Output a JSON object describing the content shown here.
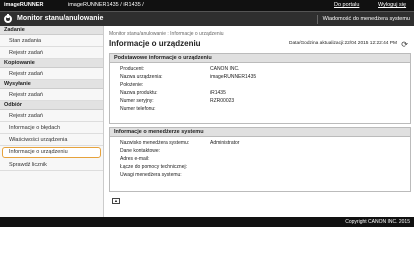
{
  "topbar": {
    "brand": "imageRUNNER",
    "device": "imageRUNNER1435 / iR1435 /",
    "portal_link": "Do portalu",
    "logout_link": "Wyloguj się"
  },
  "titlebar": {
    "title": "Monitor stanu/anulowanie",
    "message_link": "Wiadomość do menedżera systemu"
  },
  "sidebar": {
    "sections": [
      {
        "title": "Zadanie",
        "items": [
          "Stan zadania",
          "Rejestr zadań"
        ]
      },
      {
        "title": "Kopiowanie",
        "items": [
          "Rejestr zadań"
        ]
      },
      {
        "title": "Wysyłanie",
        "items": [
          "Rejestr zadań"
        ]
      },
      {
        "title": "Odbiór",
        "items": [
          "Rejestr zadań",
          "Informacje o błędach",
          "Właściwości urządzenia",
          "Informacje o urządzeniu",
          "Sprawdź licznik"
        ]
      }
    ]
  },
  "main": {
    "breadcrumb": "Monitor stanu/anulowanie : Informacje o urządzeniu",
    "title": "Informacje o urządzeniu",
    "date": "Data/Godzina aktualizacji:22/04 2015 12:22:44 PM",
    "basic": {
      "title": "Podstawowe informacje o urządzeniu",
      "rows": [
        {
          "label": "Producent:",
          "value": "CANON INC."
        },
        {
          "label": "Nazwa urządzenia:",
          "value": "imageRUNNER1435"
        },
        {
          "label": "Położenie:",
          "value": ""
        },
        {
          "label": "Nazwa produktu:",
          "value": "iR1435"
        },
        {
          "label": "Numer seryjny:",
          "value": "RZR00023"
        },
        {
          "label": "Numer telefonu:",
          "value": ""
        }
      ]
    },
    "admin": {
      "title": "Informacje o menedżerze systemu",
      "rows": [
        {
          "label": "Nazwisko menedżera systemu:",
          "value": "Administrator"
        },
        {
          "label": "Dane kontaktowe:",
          "value": ""
        },
        {
          "label": "Adres e-mail:",
          "value": ""
        },
        {
          "label": "Łącze do pomocy technicznej:",
          "value": ""
        },
        {
          "label": "Uwagi menedżera systemu:",
          "value": ""
        }
      ]
    }
  },
  "footer": {
    "copyright": "Copyright CANON INC. 2015"
  }
}
